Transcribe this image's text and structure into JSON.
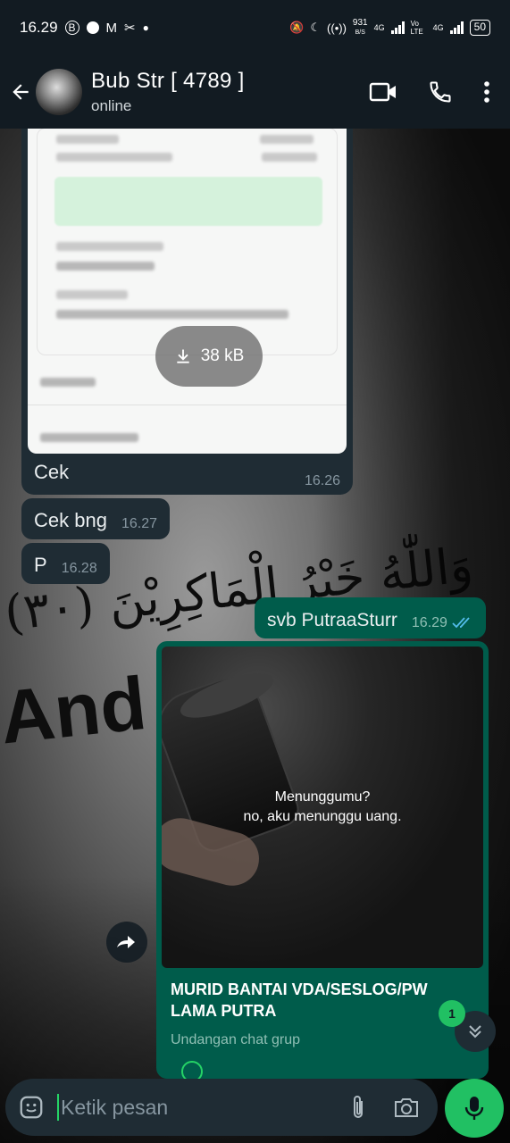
{
  "status_bar": {
    "time": "16.29",
    "net_speed": "931",
    "net_unit": "B/S",
    "net1": "4G",
    "volte": "Vo LTE",
    "net2": "4G",
    "battery": "50"
  },
  "header": {
    "contact_name": "Bub Str [ 4789 ]",
    "contact_status": "online"
  },
  "messages": {
    "image": {
      "download_size": "38 kB",
      "caption": "Cek",
      "time": "16.26"
    },
    "m2": {
      "text": "Cek bng",
      "time": "16.27"
    },
    "m3": {
      "text": "P",
      "time": "16.28"
    },
    "m4": {
      "text": "svb PutraaSturr",
      "time": "16.29"
    }
  },
  "invite": {
    "quote_line1": "Menunggumu?",
    "quote_line2": "no, aku menunggu uang.",
    "group_name": "MURID BANTAI VDA/SESLOG/PW LAMA PUTRA",
    "subtitle": "Undangan chat grup",
    "unread_count": "1"
  },
  "wallpaper": {
    "text_large": "And A"
  },
  "composer": {
    "placeholder": "Ketik pesan"
  },
  "colors": {
    "bar_bg": "#121b22",
    "incoming": "#1f2c34",
    "outgoing": "#005c4b",
    "accent": "#21c063"
  }
}
